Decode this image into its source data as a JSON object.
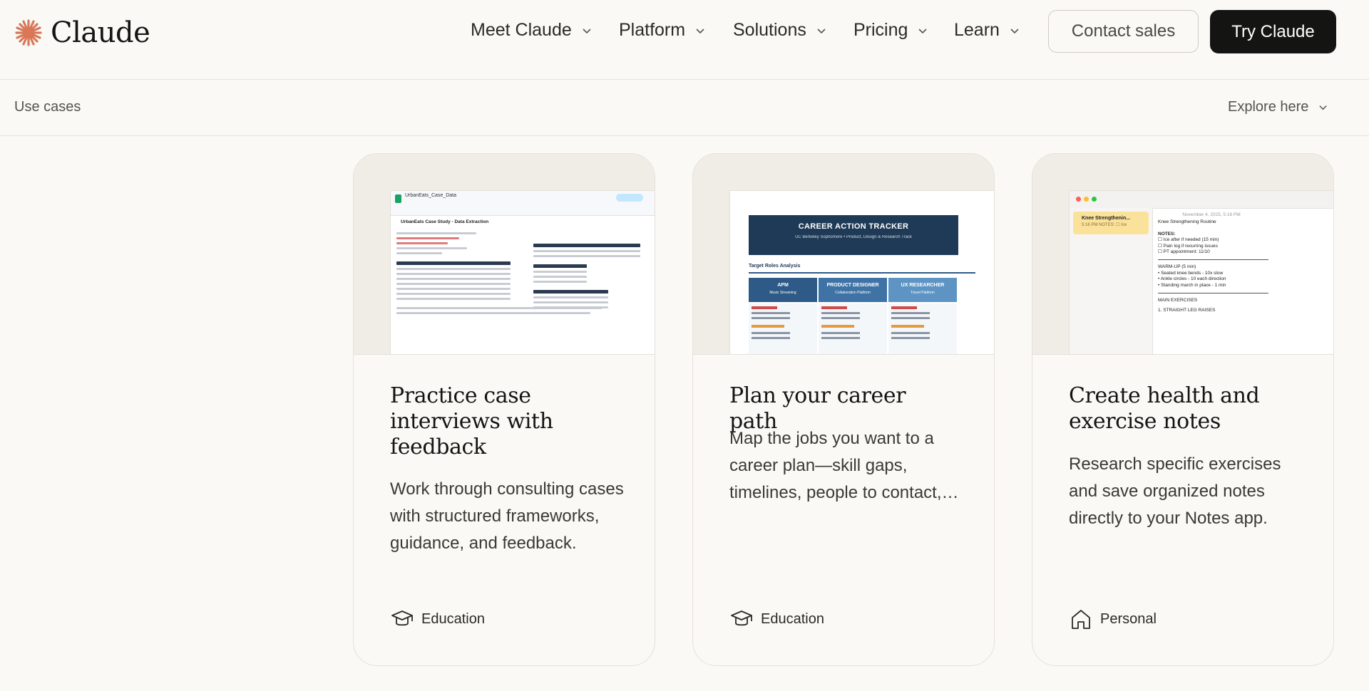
{
  "brand": {
    "name": "Claude",
    "accent": "#d97757"
  },
  "nav": {
    "items": [
      "Meet Claude",
      "Platform",
      "Solutions",
      "Pricing",
      "Learn"
    ],
    "contact_label": "Contact sales",
    "try_label": "Try Claude"
  },
  "subnav": {
    "title": "Use cases",
    "explore_label": "Explore here"
  },
  "cards": [
    {
      "title": "Practice case interviews with feedback",
      "description": "Work through consulting cases with structured frameworks, guidance, and feedback.",
      "tag": "Education",
      "tag_icon": "graduation-cap-icon",
      "preview": {
        "file_name": "UrbanEats_Case_Data",
        "sheet_title": "UrbanEats Case Study - Data Extraction"
      }
    },
    {
      "title": "Plan your career path",
      "description": "Map the jobs you want to a career plan—skill gaps, timelines, people to contact, and next steps.",
      "tag": "Education",
      "tag_icon": "graduation-cap-icon",
      "preview": {
        "header": "CAREER ACTION TRACKER",
        "subheader": "UC Berkeley Sophomore • Product, Design & Research Track",
        "section": "Target Roles Analysis",
        "roles": [
          {
            "name": "APM",
            "company": "Music Streaming",
            "color": "#2d5a86"
          },
          {
            "name": "PRODUCT DESIGNER",
            "company": "Collaboration Platform",
            "color": "#3f73a6"
          },
          {
            "name": "UX RESEARCHER",
            "company": "Travel Platform",
            "color": "#5d94c4"
          }
        ]
      }
    },
    {
      "title": "Create health and exercise notes",
      "description": "Research specific exercises and save organized notes directly to your Notes app.",
      "tag": "Personal",
      "tag_icon": "home-icon",
      "preview": {
        "note_title": "Knee Strengthenin...",
        "note_time": "5:16 PM",
        "note_snippet": "NOTES: ☐ Ice",
        "date": "November 4, 2025, 5:16 PM",
        "heading": "Knee Strengthening Routine",
        "notes_label": "NOTES:",
        "checklist": [
          "☐ Ice after if needed (15 min)",
          "☐ Pain log if recurring issues",
          "☐ PT appointment: 11/10"
        ],
        "warmup_label": "WARM-UP (5 min)",
        "warmup": [
          "• Seated knee bends - 10x slow",
          "• Ankle circles - 10 each direction",
          "• Standing march in place - 1 min"
        ],
        "main_label": "MAIN EXERCISES",
        "first_exercise": "1. STRAIGHT LEG RAISES"
      }
    }
  ]
}
